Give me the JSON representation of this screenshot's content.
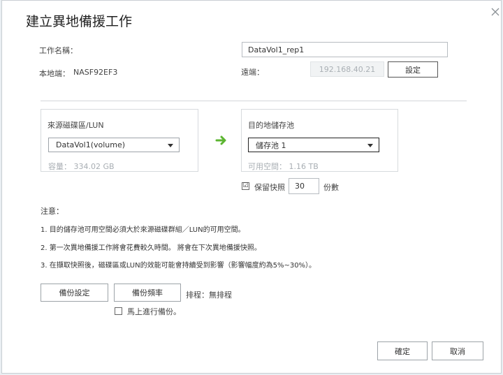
{
  "dialog": {
    "title": "建立異地備援工作",
    "close_icon": "close-icon"
  },
  "form": {
    "job_name_label": "工作名稱：",
    "job_name_value": "DataVol1_rep1",
    "local_label": "本地端：",
    "local_value": "NASF92EF3",
    "remote_label": "遠端：",
    "remote_ip": "192.168.40.21",
    "settings_button": "設定"
  },
  "source": {
    "label": "來源磁碟區/LUN",
    "selected": "DataVol1(volume)",
    "capacity": "容量： 334.02 GB"
  },
  "arrow_icon": "right-arrow-icon",
  "destination": {
    "label": "目的地儲存池",
    "selected": "儲存池 1",
    "available": "可用空間： 1.16 TB"
  },
  "snapshot": {
    "checked": true,
    "check_mark": "☑",
    "label": "保留快照",
    "count": "30",
    "unit": "份數"
  },
  "notes": {
    "heading": "注意：",
    "items": [
      "1. 目的儲存池可用空間必須大於來源磁碟群組／LUN的可用空間。",
      "2. 第一次異地備援工作將會花費較久時間。 將會在下次異地備援快照。",
      "3. 在擷取快照後，磁碟區或LUN的效能可能會持續受到影響（影響幅度約為5%~30%）。"
    ]
  },
  "actions": {
    "backup_settings": "備份設定",
    "backup_frequency": "備份頻率",
    "schedule_text": "排程：無排程",
    "run_now_label": "馬上進行備份。",
    "run_now_checked": false
  },
  "footer": {
    "confirm": "確定",
    "cancel": "取消"
  },
  "colors": {
    "arrow": "#5cb531",
    "muted_text": "#a8aeb3"
  }
}
